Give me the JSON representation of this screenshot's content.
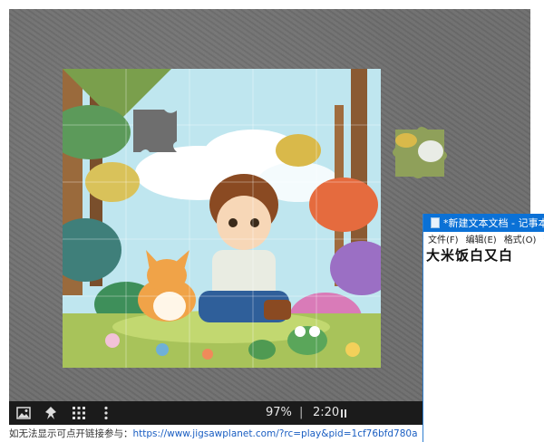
{
  "toolbar": {
    "zoom": "97%",
    "separator": "|",
    "timer": "2:20",
    "icons": [
      "image-icon",
      "ghost-icon",
      "grid-icon",
      "more-vertical-icon",
      "pause-icon"
    ]
  },
  "notepad": {
    "title": "*新建文本文档 - 记事本",
    "menu": [
      "文件(F)",
      "编辑(E)",
      "格式(O)",
      "查"
    ],
    "content": "大米饭白又白"
  },
  "footer": {
    "prefix": "如无法显示可点开链接参与：",
    "link": "https://www.jigsawplanet.com/?rc=play&pid=1cf76bfd780a"
  }
}
